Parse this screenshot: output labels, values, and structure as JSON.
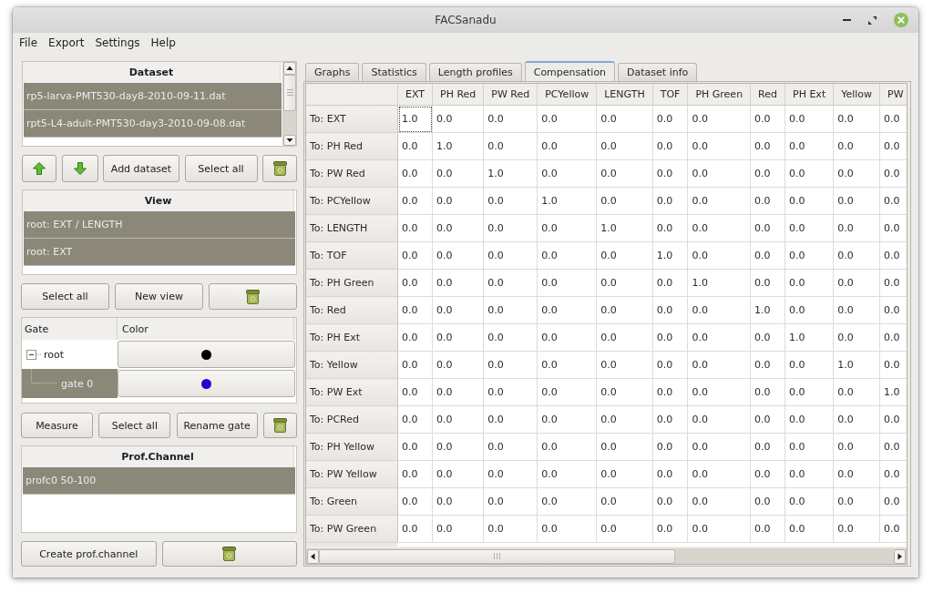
{
  "window": {
    "title": "FACSanadu"
  },
  "menu": [
    "File",
    "Export",
    "Settings",
    "Help"
  ],
  "datasets": {
    "header": "Dataset",
    "items": [
      {
        "label": "rp5-larva-PMT530-day8-2010-09-11.dat",
        "selected": true
      },
      {
        "label": "rpt5-L4-adult-PMT530-day3-2010-09-08.dat",
        "selected": true
      }
    ],
    "buttons": [
      {
        "kind": "up"
      },
      {
        "kind": "down"
      },
      {
        "kind": "text",
        "label": "Add dataset"
      },
      {
        "kind": "text",
        "label": "Select all"
      },
      {
        "kind": "trash"
      }
    ]
  },
  "views": {
    "header": "View",
    "items": [
      {
        "label": "root: EXT / LENGTH",
        "selected": true
      },
      {
        "label": "root: EXT",
        "selected": true
      }
    ],
    "buttons": [
      {
        "kind": "text",
        "label": "Select all"
      },
      {
        "kind": "text",
        "label": "New view"
      },
      {
        "kind": "trash"
      }
    ]
  },
  "gates": {
    "columns": [
      "Gate",
      "Color"
    ],
    "tree": [
      {
        "label": "root",
        "color": "#000000",
        "selected": false,
        "expanded": true,
        "children": [
          {
            "label": "gate 0",
            "color": "#2a00c8",
            "selected": true
          }
        ]
      }
    ],
    "buttons": [
      {
        "kind": "text",
        "label": "Measure"
      },
      {
        "kind": "text",
        "label": "Select all"
      },
      {
        "kind": "text",
        "label": "Rename gate"
      },
      {
        "kind": "trash"
      }
    ]
  },
  "profile_channels": {
    "header": "Prof.Channel",
    "items": [
      {
        "label": "profc0 50-100",
        "selected": true
      }
    ],
    "buttons": [
      {
        "kind": "text",
        "label": "Create prof.channel"
      },
      {
        "kind": "trash"
      }
    ]
  },
  "tabs": [
    {
      "label": "Graphs",
      "selected": false
    },
    {
      "label": "Statistics",
      "selected": false
    },
    {
      "label": "Length profiles",
      "selected": false
    },
    {
      "label": "Compensation",
      "selected": true
    },
    {
      "label": "Dataset info",
      "selected": false
    }
  ],
  "table": {
    "columns": [
      "EXT",
      "PH Red",
      "PW Red",
      "PCYellow",
      "LENGTH",
      "TOF",
      "PH Green",
      "Red",
      "PH Ext",
      "Yellow",
      "PW"
    ],
    "rows": [
      {
        "header": "To: EXT",
        "cells": [
          {
            "value": "1.0",
            "focused": true
          },
          {
            "value": "0.0",
            "focused": false
          },
          {
            "value": "0.0",
            "focused": false
          },
          {
            "value": "0.0",
            "focused": false
          },
          {
            "value": "0.0",
            "focused": false
          },
          {
            "value": "0.0",
            "focused": false
          },
          {
            "value": "0.0",
            "focused": false
          },
          {
            "value": "0.0",
            "focused": false
          },
          {
            "value": "0.0",
            "focused": false
          },
          {
            "value": "0.0",
            "focused": false
          },
          {
            "value": "0.0",
            "focused": false
          }
        ]
      },
      {
        "header": "To: PH Red",
        "cells": [
          {
            "value": "0.0",
            "focused": false
          },
          {
            "value": "1.0",
            "focused": false
          },
          {
            "value": "0.0",
            "focused": false
          },
          {
            "value": "0.0",
            "focused": false
          },
          {
            "value": "0.0",
            "focused": false
          },
          {
            "value": "0.0",
            "focused": false
          },
          {
            "value": "0.0",
            "focused": false
          },
          {
            "value": "0.0",
            "focused": false
          },
          {
            "value": "0.0",
            "focused": false
          },
          {
            "value": "0.0",
            "focused": false
          },
          {
            "value": "0.0",
            "focused": false
          }
        ]
      },
      {
        "header": "To: PW Red",
        "cells": [
          {
            "value": "0.0",
            "focused": false
          },
          {
            "value": "0.0",
            "focused": false
          },
          {
            "value": "1.0",
            "focused": false
          },
          {
            "value": "0.0",
            "focused": false
          },
          {
            "value": "0.0",
            "focused": false
          },
          {
            "value": "0.0",
            "focused": false
          },
          {
            "value": "0.0",
            "focused": false
          },
          {
            "value": "0.0",
            "focused": false
          },
          {
            "value": "0.0",
            "focused": false
          },
          {
            "value": "0.0",
            "focused": false
          },
          {
            "value": "0.0",
            "focused": false
          }
        ]
      },
      {
        "header": "To: PCYellow",
        "cells": [
          {
            "value": "0.0",
            "focused": false
          },
          {
            "value": "0.0",
            "focused": false
          },
          {
            "value": "0.0",
            "focused": false
          },
          {
            "value": "1.0",
            "focused": false
          },
          {
            "value": "0.0",
            "focused": false
          },
          {
            "value": "0.0",
            "focused": false
          },
          {
            "value": "0.0",
            "focused": false
          },
          {
            "value": "0.0",
            "focused": false
          },
          {
            "value": "0.0",
            "focused": false
          },
          {
            "value": "0.0",
            "focused": false
          },
          {
            "value": "0.0",
            "focused": false
          }
        ]
      },
      {
        "header": "To: LENGTH",
        "cells": [
          {
            "value": "0.0",
            "focused": false
          },
          {
            "value": "0.0",
            "focused": false
          },
          {
            "value": "0.0",
            "focused": false
          },
          {
            "value": "0.0",
            "focused": false
          },
          {
            "value": "1.0",
            "focused": false
          },
          {
            "value": "0.0",
            "focused": false
          },
          {
            "value": "0.0",
            "focused": false
          },
          {
            "value": "0.0",
            "focused": false
          },
          {
            "value": "0.0",
            "focused": false
          },
          {
            "value": "0.0",
            "focused": false
          },
          {
            "value": "0.0",
            "focused": false
          }
        ]
      },
      {
        "header": "To: TOF",
        "cells": [
          {
            "value": "0.0",
            "focused": false
          },
          {
            "value": "0.0",
            "focused": false
          },
          {
            "value": "0.0",
            "focused": false
          },
          {
            "value": "0.0",
            "focused": false
          },
          {
            "value": "0.0",
            "focused": false
          },
          {
            "value": "1.0",
            "focused": false
          },
          {
            "value": "0.0",
            "focused": false
          },
          {
            "value": "0.0",
            "focused": false
          },
          {
            "value": "0.0",
            "focused": false
          },
          {
            "value": "0.0",
            "focused": false
          },
          {
            "value": "0.0",
            "focused": false
          }
        ]
      },
      {
        "header": "To: PH Green",
        "cells": [
          {
            "value": "0.0",
            "focused": false
          },
          {
            "value": "0.0",
            "focused": false
          },
          {
            "value": "0.0",
            "focused": false
          },
          {
            "value": "0.0",
            "focused": false
          },
          {
            "value": "0.0",
            "focused": false
          },
          {
            "value": "0.0",
            "focused": false
          },
          {
            "value": "1.0",
            "focused": false
          },
          {
            "value": "0.0",
            "focused": false
          },
          {
            "value": "0.0",
            "focused": false
          },
          {
            "value": "0.0",
            "focused": false
          },
          {
            "value": "0.0",
            "focused": false
          }
        ]
      },
      {
        "header": "To: Red",
        "cells": [
          {
            "value": "0.0",
            "focused": false
          },
          {
            "value": "0.0",
            "focused": false
          },
          {
            "value": "0.0",
            "focused": false
          },
          {
            "value": "0.0",
            "focused": false
          },
          {
            "value": "0.0",
            "focused": false
          },
          {
            "value": "0.0",
            "focused": false
          },
          {
            "value": "0.0",
            "focused": false
          },
          {
            "value": "1.0",
            "focused": false
          },
          {
            "value": "0.0",
            "focused": false
          },
          {
            "value": "0.0",
            "focused": false
          },
          {
            "value": "0.0",
            "focused": false
          }
        ]
      },
      {
        "header": "To: PH Ext",
        "cells": [
          {
            "value": "0.0",
            "focused": false
          },
          {
            "value": "0.0",
            "focused": false
          },
          {
            "value": "0.0",
            "focused": false
          },
          {
            "value": "0.0",
            "focused": false
          },
          {
            "value": "0.0",
            "focused": false
          },
          {
            "value": "0.0",
            "focused": false
          },
          {
            "value": "0.0",
            "focused": false
          },
          {
            "value": "0.0",
            "focused": false
          },
          {
            "value": "1.0",
            "focused": false
          },
          {
            "value": "0.0",
            "focused": false
          },
          {
            "value": "0.0",
            "focused": false
          }
        ]
      },
      {
        "header": "To: Yellow",
        "cells": [
          {
            "value": "0.0",
            "focused": false
          },
          {
            "value": "0.0",
            "focused": false
          },
          {
            "value": "0.0",
            "focused": false
          },
          {
            "value": "0.0",
            "focused": false
          },
          {
            "value": "0.0",
            "focused": false
          },
          {
            "value": "0.0",
            "focused": false
          },
          {
            "value": "0.0",
            "focused": false
          },
          {
            "value": "0.0",
            "focused": false
          },
          {
            "value": "0.0",
            "focused": false
          },
          {
            "value": "1.0",
            "focused": false
          },
          {
            "value": "0.0",
            "focused": false
          }
        ]
      },
      {
        "header": "To: PW Ext",
        "cells": [
          {
            "value": "0.0",
            "focused": false
          },
          {
            "value": "0.0",
            "focused": false
          },
          {
            "value": "0.0",
            "focused": false
          },
          {
            "value": "0.0",
            "focused": false
          },
          {
            "value": "0.0",
            "focused": false
          },
          {
            "value": "0.0",
            "focused": false
          },
          {
            "value": "0.0",
            "focused": false
          },
          {
            "value": "0.0",
            "focused": false
          },
          {
            "value": "0.0",
            "focused": false
          },
          {
            "value": "0.0",
            "focused": false
          },
          {
            "value": "1.0",
            "focused": false
          }
        ]
      },
      {
        "header": "To: PCRed",
        "cells": [
          {
            "value": "0.0",
            "focused": false
          },
          {
            "value": "0.0",
            "focused": false
          },
          {
            "value": "0.0",
            "focused": false
          },
          {
            "value": "0.0",
            "focused": false
          },
          {
            "value": "0.0",
            "focused": false
          },
          {
            "value": "0.0",
            "focused": false
          },
          {
            "value": "0.0",
            "focused": false
          },
          {
            "value": "0.0",
            "focused": false
          },
          {
            "value": "0.0",
            "focused": false
          },
          {
            "value": "0.0",
            "focused": false
          },
          {
            "value": "0.0",
            "focused": false
          }
        ]
      },
      {
        "header": "To: PH Yellow",
        "cells": [
          {
            "value": "0.0",
            "focused": false
          },
          {
            "value": "0.0",
            "focused": false
          },
          {
            "value": "0.0",
            "focused": false
          },
          {
            "value": "0.0",
            "focused": false
          },
          {
            "value": "0.0",
            "focused": false
          },
          {
            "value": "0.0",
            "focused": false
          },
          {
            "value": "0.0",
            "focused": false
          },
          {
            "value": "0.0",
            "focused": false
          },
          {
            "value": "0.0",
            "focused": false
          },
          {
            "value": "0.0",
            "focused": false
          },
          {
            "value": "0.0",
            "focused": false
          }
        ]
      },
      {
        "header": "To: PW Yellow",
        "cells": [
          {
            "value": "0.0",
            "focused": false
          },
          {
            "value": "0.0",
            "focused": false
          },
          {
            "value": "0.0",
            "focused": false
          },
          {
            "value": "0.0",
            "focused": false
          },
          {
            "value": "0.0",
            "focused": false
          },
          {
            "value": "0.0",
            "focused": false
          },
          {
            "value": "0.0",
            "focused": false
          },
          {
            "value": "0.0",
            "focused": false
          },
          {
            "value": "0.0",
            "focused": false
          },
          {
            "value": "0.0",
            "focused": false
          },
          {
            "value": "0.0",
            "focused": false
          }
        ]
      },
      {
        "header": "To: Green",
        "cells": [
          {
            "value": "0.0",
            "focused": false
          },
          {
            "value": "0.0",
            "focused": false
          },
          {
            "value": "0.0",
            "focused": false
          },
          {
            "value": "0.0",
            "focused": false
          },
          {
            "value": "0.0",
            "focused": false
          },
          {
            "value": "0.0",
            "focused": false
          },
          {
            "value": "0.0",
            "focused": false
          },
          {
            "value": "0.0",
            "focused": false
          },
          {
            "value": "0.0",
            "focused": false
          },
          {
            "value": "0.0",
            "focused": false
          },
          {
            "value": "0.0",
            "focused": false
          }
        ]
      },
      {
        "header": "To: PW Green",
        "cells": [
          {
            "value": "0.0",
            "focused": false
          },
          {
            "value": "0.0",
            "focused": false
          },
          {
            "value": "0.0",
            "focused": false
          },
          {
            "value": "0.0",
            "focused": false
          },
          {
            "value": "0.0",
            "focused": false
          },
          {
            "value": "0.0",
            "focused": false
          },
          {
            "value": "0.0",
            "focused": false
          },
          {
            "value": "0.0",
            "focused": false
          },
          {
            "value": "0.0",
            "focused": false
          },
          {
            "value": "0.0",
            "focused": false
          },
          {
            "value": "0.0",
            "focused": false
          }
        ]
      }
    ]
  }
}
